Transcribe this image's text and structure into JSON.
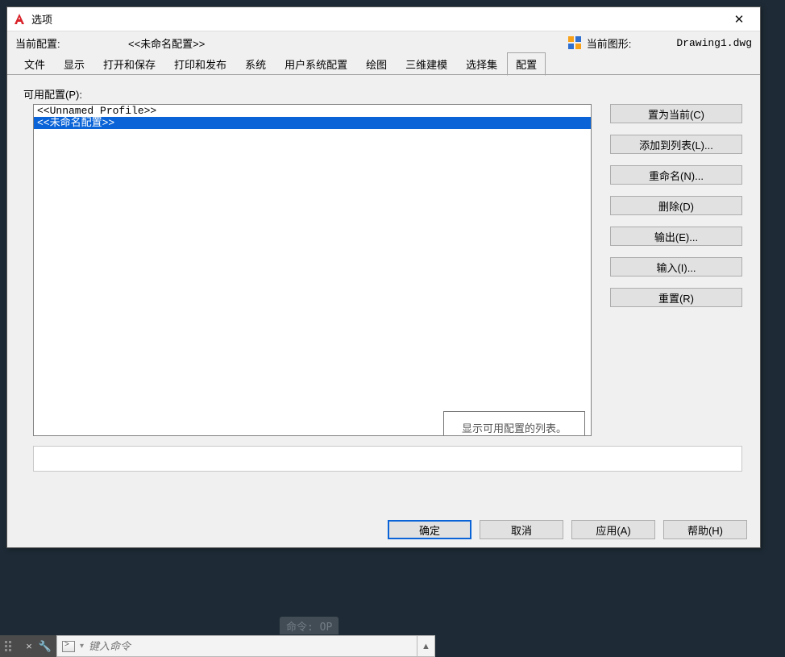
{
  "window": {
    "title": "选项",
    "close_glyph": "✕"
  },
  "info": {
    "current_config_label": "当前配置:",
    "current_config_value": "<<未命名配置>>",
    "current_drawing_label": "当前图形:",
    "current_drawing_value": "Drawing1.dwg"
  },
  "tabs": [
    {
      "label": "文件"
    },
    {
      "label": "显示"
    },
    {
      "label": "打开和保存"
    },
    {
      "label": "打印和发布"
    },
    {
      "label": "系统"
    },
    {
      "label": "用户系统配置"
    },
    {
      "label": "绘图"
    },
    {
      "label": "三维建模"
    },
    {
      "label": "选择集"
    },
    {
      "label": "配置"
    }
  ],
  "active_tab_index": 9,
  "profiles": {
    "available_label": "可用配置(P):",
    "items": [
      {
        "text": "<<Unnamed Profile>>",
        "selected": false
      },
      {
        "text": "<<未命名配置>>",
        "selected": true
      }
    ],
    "tooltip": "显示可用配置的列表。"
  },
  "side_buttons": [
    {
      "label": "置为当前(C)"
    },
    {
      "label": "添加到列表(L)..."
    },
    {
      "label": "重命名(N)..."
    },
    {
      "label": "删除(D)"
    },
    {
      "label": "输出(E)..."
    },
    {
      "label": "输入(I)..."
    },
    {
      "label": "重置(R)"
    }
  ],
  "footer_buttons": {
    "ok": "确定",
    "cancel": "取消",
    "apply": "应用(A)",
    "help": "帮助(H)"
  },
  "command": {
    "history": "命令: OP",
    "placeholder": "键入命令",
    "close_glyph": "×",
    "wrench_glyph": "🔧",
    "expand_glyph": "▲"
  }
}
